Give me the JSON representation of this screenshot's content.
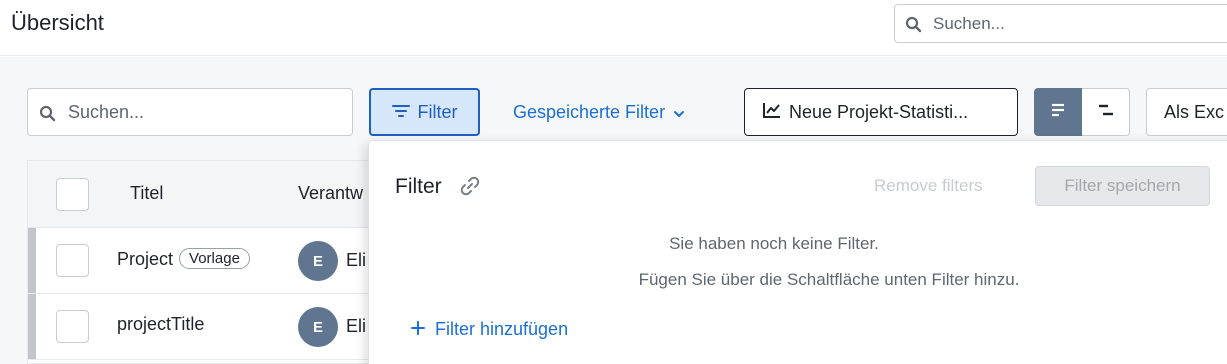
{
  "header": {
    "title": "Übersicht",
    "search_placeholder": "Suchen..."
  },
  "toolbar": {
    "search_placeholder": "Suchen...",
    "filter_label": "Filter",
    "saved_filters_label": "Gespeicherte Filter",
    "stats_label": "Neue Projekt-Statisti...",
    "excel_label": "Als Exc"
  },
  "table": {
    "columns": [
      "Titel",
      "Verantw"
    ],
    "rows": [
      {
        "title": "Project",
        "badge": "Vorlage",
        "avatar": "E",
        "owner": "Eli"
      },
      {
        "title": "projectTitle",
        "badge": "",
        "avatar": "E",
        "owner": "Eli"
      }
    ]
  },
  "filter_panel": {
    "title": "Filter",
    "remove_label": "Remove filters",
    "save_label": "Filter speichern",
    "empty_line1": "Sie haben noch keine Filter.",
    "empty_line2": "Fügen Sie über die Schaltfläche unten Filter hinzu.",
    "add_label": "Filter hinzufügen"
  },
  "colors": {
    "accent": "#1a6fd6",
    "active_view": "#5f7590",
    "filter_active_bg": "#d6e6fb"
  }
}
